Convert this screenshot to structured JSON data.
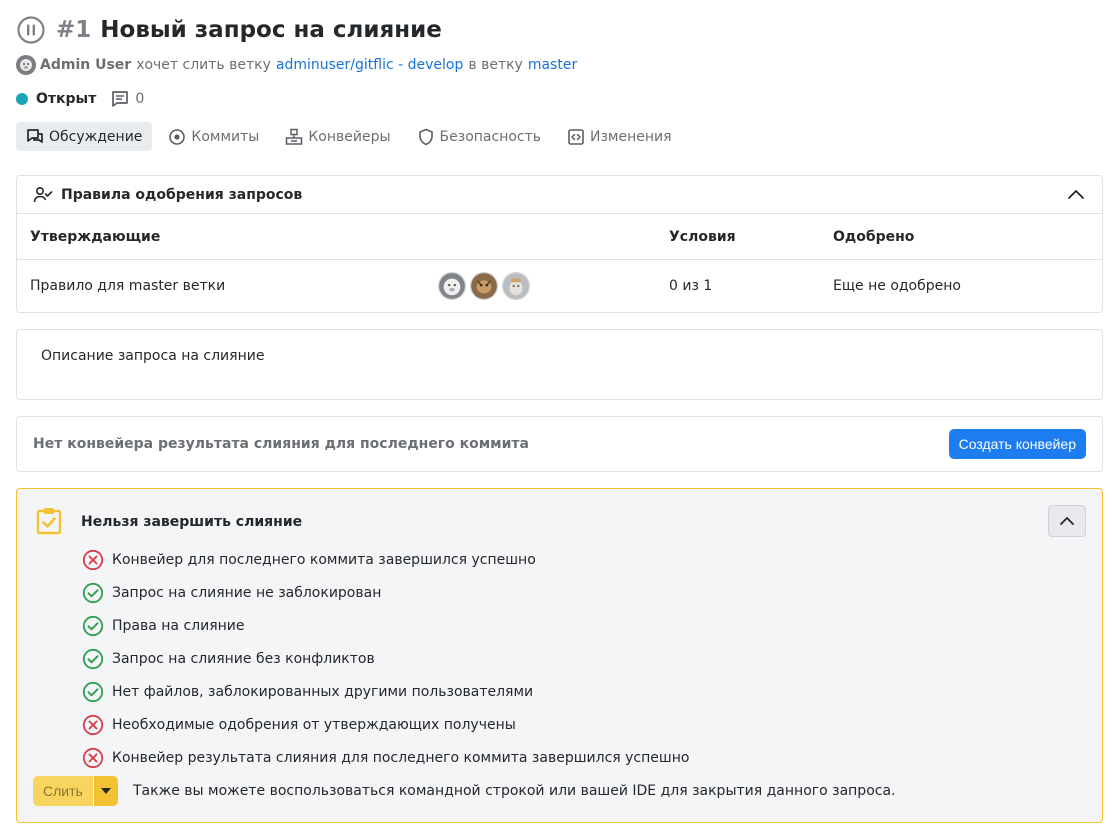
{
  "header": {
    "number": "#1",
    "title": "Новый запрос на слияние"
  },
  "meta": {
    "author": "Admin User",
    "wants_merge": "хочет слить ветку",
    "source_branch": "adminuser/gitflic - develop",
    "into_branch": "в ветку",
    "target_branch": "master"
  },
  "status": {
    "label": "Открыт",
    "comments": "0",
    "color": "#1ba5b8"
  },
  "tabs": [
    {
      "label": "Обсуждение",
      "icon": "discussion-icon"
    },
    {
      "label": "Коммиты",
      "icon": "commit-icon"
    },
    {
      "label": "Конвейеры",
      "icon": "pipeline-icon"
    },
    {
      "label": "Безопасность",
      "icon": "shield-icon"
    },
    {
      "label": "Изменения",
      "icon": "code-icon"
    }
  ],
  "approval_rules": {
    "title": "Правила одобрения запросов",
    "columns": [
      "Утверждающие",
      "Условия",
      "Одобрено"
    ],
    "rows": [
      {
        "name": "Правило для master ветки",
        "condition": "0 из 1",
        "approved": "Еще не одобрено"
      }
    ]
  },
  "description": {
    "text": "Описание запроса на слияние"
  },
  "pipeline": {
    "text": "Нет конвейера результата слияния для последнего коммита",
    "button": "Создать конвейер"
  },
  "merge": {
    "title": "Нельзя завершить слияние",
    "checks": [
      {
        "label": "Конвейер для последнего коммита завершился успешно",
        "ok": false
      },
      {
        "label": "Запрос на слияние не заблокирован",
        "ok": true
      },
      {
        "label": "Права на слияние",
        "ok": true
      },
      {
        "label": "Запрос на слияние без конфликтов",
        "ok": true
      },
      {
        "label": "Нет файлов, заблокированных другими пользователями",
        "ok": true
      },
      {
        "label": "Необходимые одобрения от утверждающих получены",
        "ok": false
      },
      {
        "label": "Конвейер результата слияния для последнего коммита завершился успешно",
        "ok": false
      }
    ],
    "button": "Слить",
    "hint": "Также вы можете воспользоваться командной строкой или вашей IDE для закрытия данного запроса."
  },
  "colors": {
    "link": "#1872d8",
    "primary": "#1c7cf0",
    "warning": "#f2c233",
    "success": "#2e9e4f",
    "error": "#d93b4a"
  }
}
